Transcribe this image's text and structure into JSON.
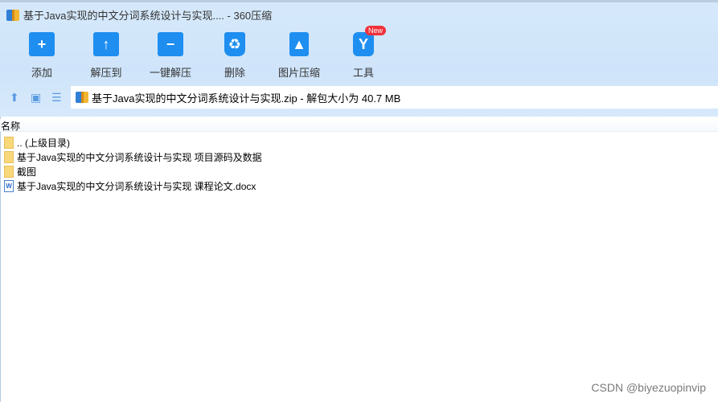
{
  "window": {
    "title": "基于Java实现的中文分词系统设计与实现.... - 360压缩"
  },
  "toolbar": [
    {
      "label": "添加",
      "icon": "add-folder-icon",
      "glyph": "+"
    },
    {
      "label": "解压到",
      "icon": "extract-to-icon",
      "glyph": "↑"
    },
    {
      "label": "一键解压",
      "icon": "one-click-extract-icon",
      "glyph": "−"
    },
    {
      "label": "删除",
      "icon": "delete-icon",
      "glyph": "♻"
    },
    {
      "label": "图片压缩",
      "icon": "image-compress-icon",
      "glyph": "▲"
    },
    {
      "label": "工具",
      "icon": "tools-icon",
      "glyph": "Y",
      "badge": "New"
    }
  ],
  "address": {
    "text": "基于Java实现的中文分词系统设计与实现.zip - 解包大小为 40.7 MB"
  },
  "list": {
    "header": "名称",
    "items": [
      {
        "name": ".. (上级目录)",
        "type": "folder"
      },
      {
        "name": "基于Java实现的中文分词系统设计与实现 项目源码及数据",
        "type": "folder"
      },
      {
        "name": "截图",
        "type": "folder"
      },
      {
        "name": "基于Java实现的中文分词系统设计与实现 课程论文.docx",
        "type": "docx"
      }
    ]
  },
  "watermark": "CSDN @biyezuopinvip"
}
